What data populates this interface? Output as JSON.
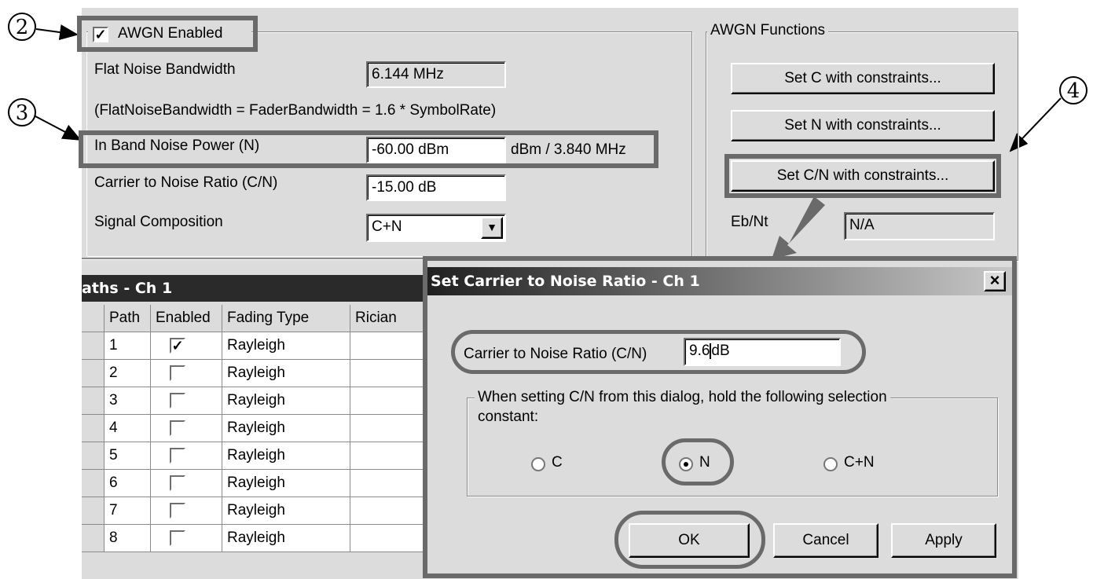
{
  "callouts": [
    "2",
    "3",
    "4"
  ],
  "awgn": {
    "enabled_label": "AWGN Enabled",
    "enabled_checked": "✓",
    "flat_noise_bw_label": "Flat Noise Bandwidth",
    "flat_noise_bw_value": "6.144 MHz",
    "formula_note": "(FlatNoiseBandwidth = FaderBandwidth = 1.6 * SymbolRate)",
    "in_band_noise_label": "In Band Noise Power (N)",
    "in_band_noise_value": "-60.00 dBm",
    "in_band_noise_unit": "dBm / 3.840 MHz",
    "cn_ratio_label": "Carrier to Noise Ratio (C/N)",
    "cn_ratio_value": "-15.00 dB",
    "signal_comp_label": "Signal Composition",
    "signal_comp_value": "C+N"
  },
  "functions": {
    "group_label": "AWGN Functions",
    "set_c": "Set C with constraints...",
    "set_n": "Set N with constraints...",
    "set_cn": "Set C/N with constraints...",
    "ebnt_label": "Eb/Nt",
    "ebnt_value": "N/A"
  },
  "paths": {
    "title": "aths - Ch 1",
    "headers": [
      "Path",
      "Enabled",
      "Fading Type",
      "Rician"
    ],
    "rows": [
      {
        "path": "1",
        "enabled": "✓",
        "fading": "Rayleigh"
      },
      {
        "path": "2",
        "enabled": "",
        "fading": "Rayleigh"
      },
      {
        "path": "3",
        "enabled": "",
        "fading": "Rayleigh"
      },
      {
        "path": "4",
        "enabled": "",
        "fading": "Rayleigh"
      },
      {
        "path": "5",
        "enabled": "",
        "fading": "Rayleigh"
      },
      {
        "path": "6",
        "enabled": "",
        "fading": "Rayleigh"
      },
      {
        "path": "7",
        "enabled": "",
        "fading": "Rayleigh"
      },
      {
        "path": "8",
        "enabled": "",
        "fading": "Rayleigh"
      }
    ]
  },
  "dialog": {
    "title": "Set Carrier to Noise Ratio - Ch 1",
    "close": "×",
    "cn_label": "Carrier to Noise Ratio (C/N)",
    "cn_value": "9.6",
    "cn_unit": "dB",
    "group_label": "When setting C/N from this dialog, hold the following selection",
    "group_label2": "constant:",
    "options": [
      "C",
      "N",
      "C+N"
    ],
    "selected": "N",
    "ok": "OK",
    "cancel": "Cancel",
    "apply": "Apply"
  }
}
